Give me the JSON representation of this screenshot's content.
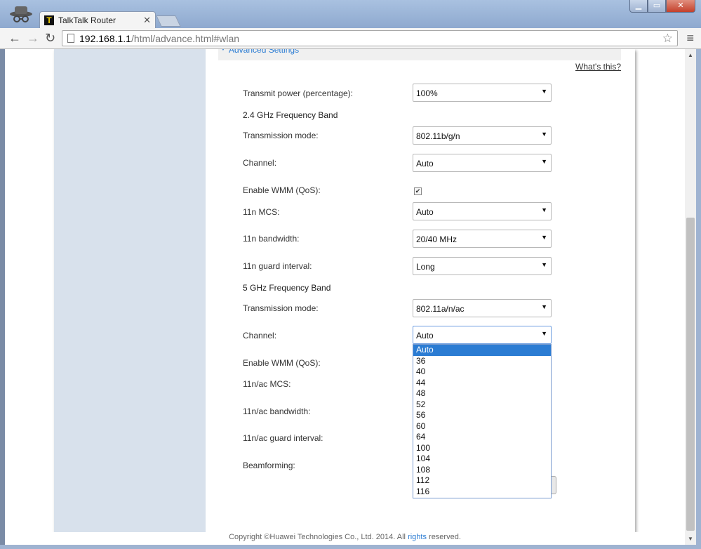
{
  "browser": {
    "tab_title": "TalkTalk Router",
    "tab_close": "✕",
    "favicon_letter": "T",
    "url_host": "192.168.1.1",
    "url_path": "/html/advance.html#wlan",
    "window_buttons": {
      "minimize": "▁",
      "maximize": "▭",
      "close": "✕"
    },
    "icons": {
      "back": "←",
      "forward": "→",
      "reload": "↻",
      "star": "☆",
      "menu": "≡"
    }
  },
  "page": {
    "advanced_settings": "Advanced Settings",
    "whats_this": "What's this?",
    "transmit_power_label": "Transmit power (percentage):",
    "transmit_power_value": "100%",
    "band24_title": "2.4 GHz Frequency Band",
    "band24": {
      "transmission_mode_label": "Transmission mode:",
      "transmission_mode_value": "802.11b/g/n",
      "channel_label": "Channel:",
      "channel_value": "Auto",
      "wmm_label": "Enable WMM (QoS):",
      "wmm_checked": true,
      "mcs_label": "11n MCS:",
      "mcs_value": "Auto",
      "bandwidth_label": "11n bandwidth:",
      "bandwidth_value": "20/40 MHz",
      "guard_label": "11n guard interval:",
      "guard_value": "Long"
    },
    "band5_title": "5 GHz Frequency Band",
    "band5": {
      "transmission_mode_label": "Transmission mode:",
      "transmission_mode_value": "802.11a/n/ac",
      "channel_label": "Channel:",
      "channel_value": "Auto",
      "wmm_label": "Enable WMM (QoS):",
      "mcs_label": "11n/ac MCS:",
      "bandwidth_label": "11n/ac bandwidth:",
      "guard_label": "11n/ac guard interval:",
      "beamforming_label": "Beamforming:"
    },
    "channel_options": [
      "Auto",
      "36",
      "40",
      "44",
      "48",
      "52",
      "56",
      "60",
      "64",
      "100",
      "104",
      "108",
      "112",
      "116"
    ],
    "channel_selected": "Auto",
    "copyright_prefix": "Copyright ©Huawei Technologies Co., Ltd. 2014. All",
    "copyright_link": "rights",
    "copyright_suffix": "reserved.",
    "colors": {
      "accent": "#2b7cd3",
      "sidebar": "#d8e1ec"
    }
  }
}
